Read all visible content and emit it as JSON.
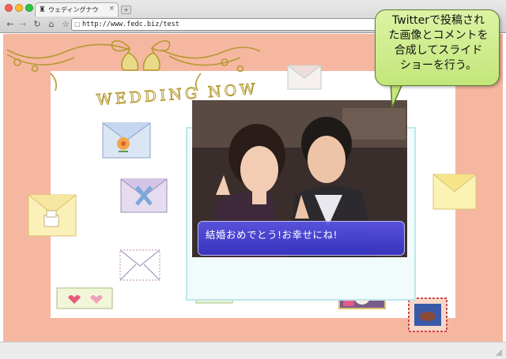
{
  "browser": {
    "tab_title": "ウェディングナウ",
    "tab_close": "×",
    "new_tab": "+",
    "url": "http://www.fedc.biz/test",
    "nav": {
      "back": "←",
      "forward": "→",
      "reload": "↻",
      "home": "⌂",
      "star": "☆"
    }
  },
  "page": {
    "wedding_title": "WEDDING NOW",
    "caption": "結婚おめでとう!お幸せにね!"
  },
  "callout": {
    "text": "Twitterで投稿され\nた画像とコメントを\n合成してスライド\nショーを行う。"
  },
  "colors": {
    "page_background": "#f6b7a1",
    "gold": "#b59a30",
    "caption_blue": "#4a46dc",
    "callout_green": "#c8ec84"
  },
  "icons": [
    "back-arrow-icon",
    "forward-arrow-icon",
    "reload-icon",
    "home-icon",
    "star-icon",
    "envelope-icon",
    "photo-icon"
  ]
}
